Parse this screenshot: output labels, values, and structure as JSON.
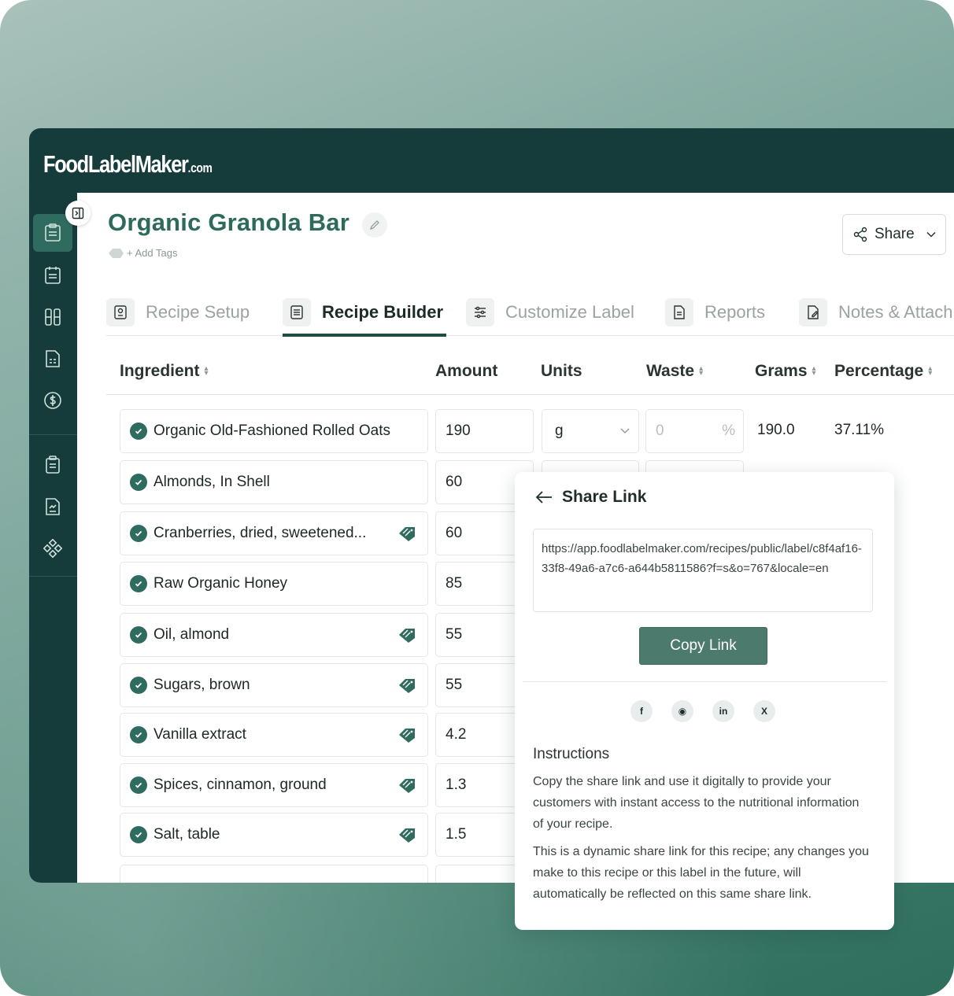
{
  "brand": {
    "name": "FoodLabelMaker",
    "suffix": ".com"
  },
  "recipe": {
    "title": "Organic Granola Bar",
    "add_tags": "+ Add Tags"
  },
  "share_button": {
    "label": "Share"
  },
  "tabs": [
    {
      "label": "Recipe Setup",
      "active": false
    },
    {
      "label": "Recipe Builder",
      "active": true
    },
    {
      "label": "Customize Label",
      "active": false
    },
    {
      "label": "Reports",
      "active": false
    },
    {
      "label": "Notes & Attach",
      "active": false
    }
  ],
  "table": {
    "headers": {
      "ingredient": "Ingredient",
      "amount": "Amount",
      "units": "Units",
      "waste": "Waste",
      "grams": "Grams",
      "percentage": "Percentage"
    },
    "first_row": {
      "unit": "g",
      "waste": "0",
      "waste_unit": "%",
      "grams": "190.0",
      "percentage": "37.11%"
    },
    "rows": [
      {
        "name": "Organic Old-Fashioned Rolled Oats",
        "amount": "190",
        "tagged": false
      },
      {
        "name": "Almonds, In Shell",
        "amount": "60",
        "tagged": false
      },
      {
        "name": "Cranberries, dried, sweetened...",
        "amount": "60",
        "tagged": true
      },
      {
        "name": "Raw Organic Honey",
        "amount": "85",
        "tagged": false
      },
      {
        "name": "Oil, almond",
        "amount": "55",
        "tagged": true
      },
      {
        "name": "Sugars, brown",
        "amount": "55",
        "tagged": true
      },
      {
        "name": "Vanilla extract",
        "amount": "4.2",
        "tagged": true
      },
      {
        "name": "Spices, cinnamon, ground",
        "amount": "1.3",
        "tagged": true
      },
      {
        "name": "Salt, table",
        "amount": "1.5",
        "tagged": true
      }
    ]
  },
  "share_popup": {
    "title": "Share Link",
    "url": "https://app.foodlabelmaker.com/recipes/public/label/c8f4af16-33f8-49a6-a7c6-a644b5811586?f=s&o=767&locale=en",
    "copy_label": "Copy Link",
    "socials": [
      {
        "icon": "facebook-icon",
        "glyph": "f"
      },
      {
        "icon": "whatsapp-icon",
        "glyph": "◉"
      },
      {
        "icon": "linkedin-icon",
        "glyph": "in"
      },
      {
        "icon": "x-icon",
        "glyph": "X"
      }
    ],
    "instructions_title": "Instructions",
    "instructions_p1": "Copy the share link and use it digitally to provide your customers with instant access to the nutritional information of your recipe.",
    "instructions_p2": "This is a dynamic share link for this recipe; any changes you make to this recipe or this label in the future, will automatically be reflected on this same share link."
  },
  "colors": {
    "brand_dark": "#153b3b",
    "accent": "#2d6a5c",
    "button": "#4c7a6d"
  }
}
